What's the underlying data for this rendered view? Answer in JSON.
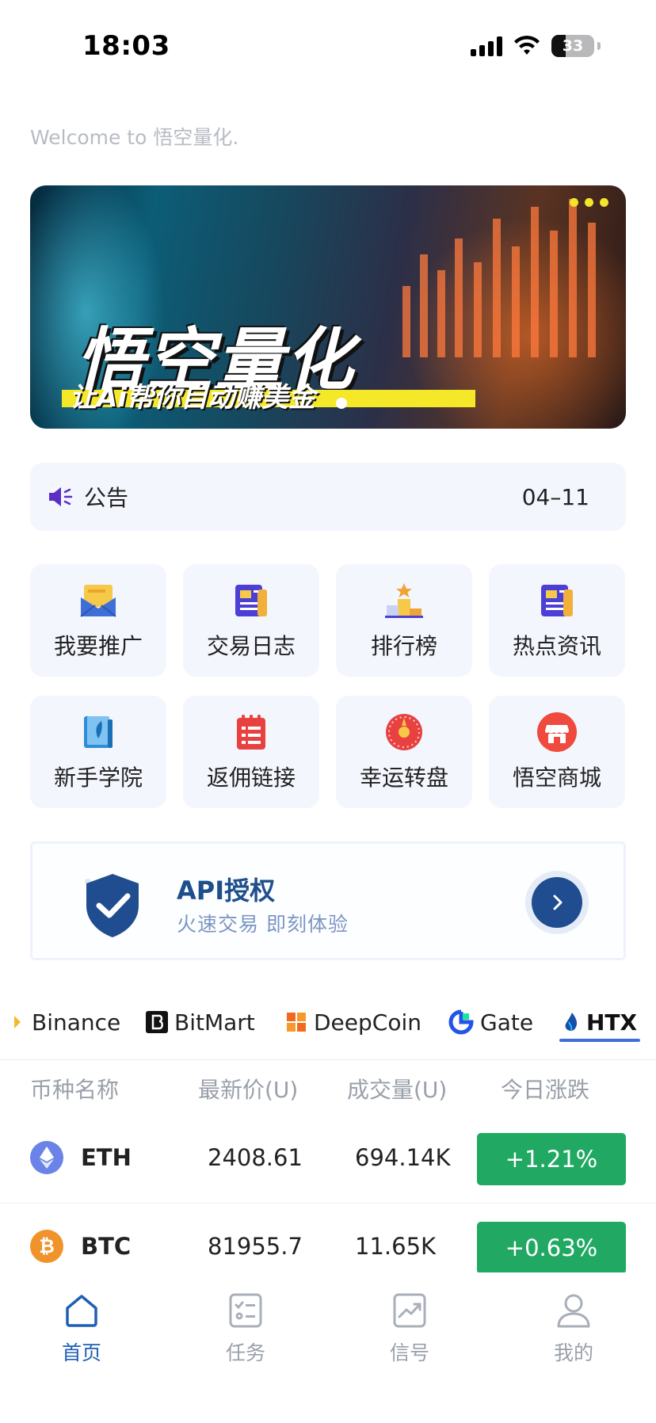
{
  "status_bar": {
    "time": "18:03",
    "battery": "33",
    "battery_level": 0.33
  },
  "welcome": "Welcome to 悟空量化.",
  "banner": {
    "title": "悟空量化",
    "subtitle": "让Ai帮你自动赚美金"
  },
  "notice": {
    "icon": "speaker-icon",
    "label": "公告",
    "date": "04–11"
  },
  "quick_menu": [
    {
      "label": "我要推广",
      "icon": "envelope-icon",
      "color": "#f5b93a"
    },
    {
      "label": "交易日志",
      "icon": "news-icon",
      "color": "#4b3fd6"
    },
    {
      "label": "排行榜",
      "icon": "podium-icon",
      "color": "#f0a436"
    },
    {
      "label": "热点资讯",
      "icon": "news-icon",
      "color": "#4b3fd6"
    },
    {
      "label": "新手学院",
      "icon": "book-icon",
      "color": "#2f8ed8"
    },
    {
      "label": "返佣链接",
      "icon": "calendar-list-icon",
      "color": "#e8413f"
    },
    {
      "label": "幸运转盘",
      "icon": "wheel-icon",
      "color": "#e8413f"
    },
    {
      "label": "悟空商城",
      "icon": "store-icon",
      "color": "#ef4a3d"
    }
  ],
  "api_card": {
    "title": "API授权",
    "subtitle": "火速交易  即刻体验"
  },
  "exchanges": [
    {
      "name": "Binance",
      "icon": "binance-icon",
      "active": false
    },
    {
      "name": "BitMart",
      "icon": "bitmart-icon",
      "active": false
    },
    {
      "name": "DeepCoin",
      "icon": "deepcoin-icon",
      "active": false
    },
    {
      "name": "Gate",
      "icon": "gate-icon",
      "active": false
    },
    {
      "name": "HTX",
      "icon": "htx-icon",
      "active": true
    }
  ],
  "market": {
    "headers": [
      "币种名称",
      "最新价(U)",
      "成交量(U)",
      "今日涨跌"
    ],
    "rows": [
      {
        "symbol": "ETH",
        "price": "2408.61",
        "volume": "694.14K",
        "change": "+1.21%",
        "icon": "ethereum-icon",
        "color": "#6b83e8"
      },
      {
        "symbol": "BTC",
        "price": "81955.7",
        "volume": "11.65K",
        "change": "+0.63%",
        "icon": "bitcoin-icon",
        "color": "#f0932b"
      }
    ],
    "positive_color": "#21a963"
  },
  "bottom_nav": [
    {
      "label": "首页",
      "icon": "home-icon",
      "active": true
    },
    {
      "label": "任务",
      "icon": "task-icon",
      "active": false
    },
    {
      "label": "信号",
      "icon": "signal-chart-icon",
      "active": false
    },
    {
      "label": "我的",
      "icon": "profile-icon",
      "active": false
    }
  ],
  "accent_color": "#1e5fb4"
}
